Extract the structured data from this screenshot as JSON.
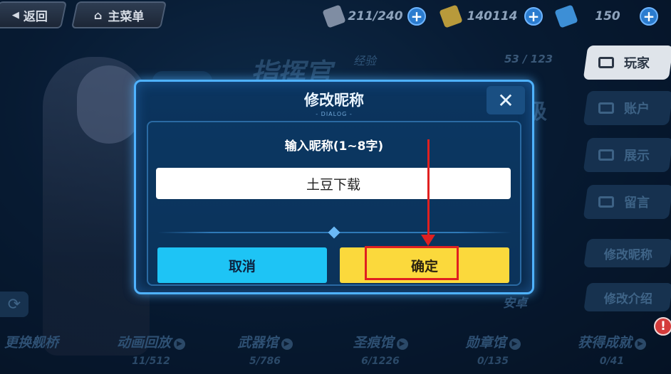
{
  "topbar": {
    "back_label": "返回",
    "home_label": "主菜单",
    "stamina_value": "211/240",
    "coins_value": "140114",
    "crystals_value": "150",
    "plus": "+"
  },
  "background": {
    "commander_title": "指挥官",
    "exp_label": "经验",
    "exp_value": "53 / 123",
    "level_char": "级",
    "badge_glyph": "!",
    "anyo_label": "安卓"
  },
  "side_menu": {
    "tabs": [
      {
        "label": "玩家",
        "icon": "id-card-icon"
      },
      {
        "label": "账户",
        "icon": "folder-icon"
      },
      {
        "label": "展示",
        "icon": "display-icon"
      },
      {
        "label": "留言",
        "icon": "message-icon"
      }
    ],
    "edit_name_label": "修改昵称",
    "edit_intro_label": "修改介绍"
  },
  "bottom_nav": {
    "change_bridge": "更换舰桥",
    "refresh_glyph": "⟳",
    "alert_glyph": "!",
    "arrow_glyph": "▶",
    "items": [
      {
        "label": "动画回放",
        "count": "11/512"
      },
      {
        "label": "武器馆",
        "count": "5/786"
      },
      {
        "label": "圣痕馆",
        "count": "6/1226"
      },
      {
        "label": "勋章馆",
        "count": "0/135"
      },
      {
        "label": "获得成就",
        "count": "0/41"
      }
    ]
  },
  "dialog": {
    "title": "修改昵称",
    "subtitle": "- DIALOG -",
    "close_glyph": "✕",
    "prompt": "输入昵称(1~8字)",
    "input_value": "土豆下载",
    "cancel_label": "取消",
    "confirm_label": "确定"
  },
  "colors": {
    "accent_blue": "#4fb2ff",
    "cancel_cyan": "#1ec4f5",
    "confirm_yellow": "#fbd93c",
    "annotation_red": "#e02020"
  }
}
